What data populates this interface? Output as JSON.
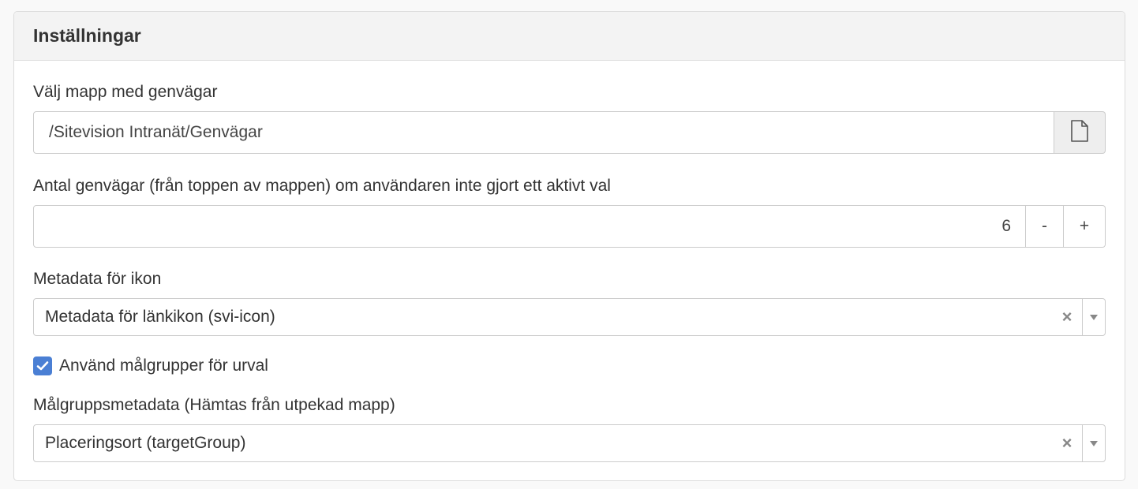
{
  "panel": {
    "title": "Inställningar"
  },
  "folder": {
    "label": "Välj mapp med genvägar",
    "value": "/Sitevision Intranät/Genvägar",
    "browse_icon": "file-icon"
  },
  "count": {
    "label": "Antal genvägar (från toppen av mappen) om användaren inte gjort ett aktivt val",
    "value": "6",
    "decrement_label": "-",
    "increment_label": "+"
  },
  "icon_metadata": {
    "label": "Metadata för ikon",
    "selected": "Metadata för länkikon (svi-icon)",
    "clear_symbol": "×"
  },
  "target_groups": {
    "checkbox_label": "Använd målgrupper för urval",
    "checked": true
  },
  "group_metadata": {
    "label": "Målgruppsmetadata (Hämtas från utpekad mapp)",
    "selected": "Placeringsort (targetGroup)",
    "clear_symbol": "×"
  },
  "colors": {
    "accent": "#4a7fd4",
    "header_bg": "#f3f3f3",
    "border": "#cccccc"
  }
}
